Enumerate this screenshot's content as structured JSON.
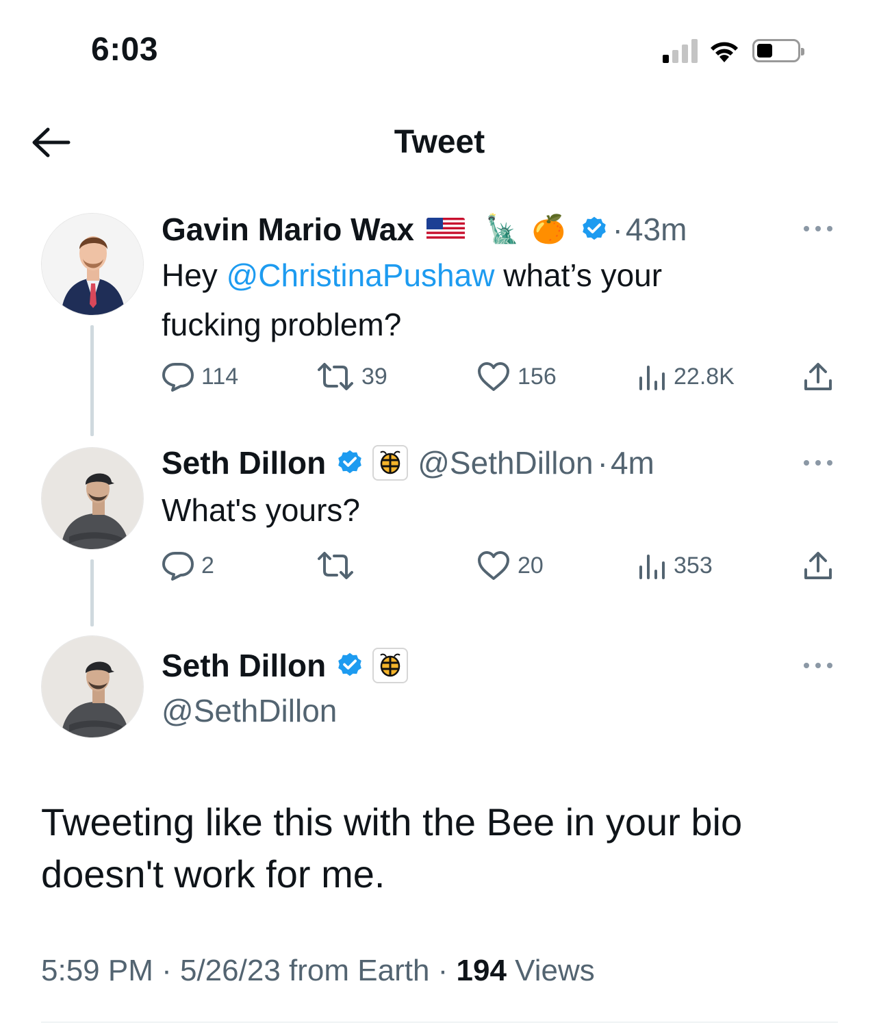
{
  "status_bar": {
    "time": "6:03",
    "signal_bars_active": 1,
    "signal_bars_total": 4,
    "battery_level_percent": 30
  },
  "header": {
    "back_icon": "arrow-left-icon",
    "title": "Tweet"
  },
  "thread": [
    {
      "display_name": "Gavin Mario Wax",
      "name_emojis": [
        "flag-usa-icon",
        "statue-of-liberty-icon",
        "orange-icon"
      ],
      "statue_emoji": "🗽",
      "orange_emoji": "🍊",
      "verified": true,
      "separator": "·",
      "time_ago": "43m",
      "text_prefix": "Hey ",
      "mention": "@ChristinaPushaw",
      "text_suffix_line1": " what’s your",
      "text_line2": "fucking problem?",
      "replies": "114",
      "retweets": "39",
      "likes": "156",
      "views": "22.8K"
    },
    {
      "display_name": "Seth Dillon",
      "verified": true,
      "affiliate_badge": "babylon-bee-badge-icon",
      "handle": "@SethDillon",
      "separator": "·",
      "time_ago": "4m",
      "text": "What's yours?",
      "replies": "2",
      "retweets": "",
      "likes": "20",
      "views": "353"
    }
  ],
  "focused_tweet": {
    "display_name": "Seth Dillon",
    "verified": true,
    "affiliate_badge": "babylon-bee-badge-icon",
    "handle": "@SethDillon",
    "text": "Tweeting like this with the Bee in your bio doesn't work for me.",
    "time": "5:59 PM",
    "sep1": " · ",
    "date": "5/26/23",
    "source": " from Earth",
    "sep2": " · ",
    "views_count": "194",
    "views_label": " Views"
  },
  "colors": {
    "link": "#1d9bf0",
    "verified": "#1d9bf0",
    "secondary_text": "#536471",
    "thread_line": "#cfd9de"
  }
}
